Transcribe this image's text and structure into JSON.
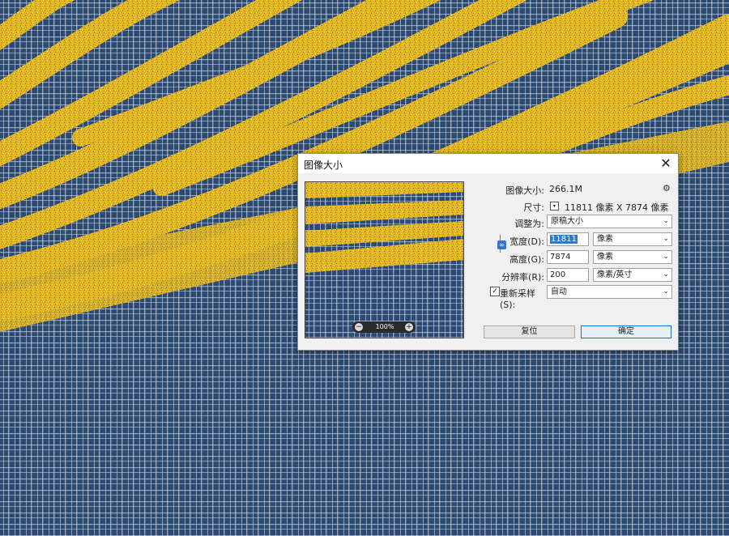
{
  "dialog": {
    "title": "图像大小",
    "close": "✕",
    "image_size_label": "图像大小:",
    "image_size_value": "266.1M",
    "dimensions_label": "尺寸:",
    "dimensions_value": "11811 像素  X  7874 像素",
    "fit_to_label": "调整为:",
    "fit_to_value": "原稿大小",
    "width_label": "宽度(D):",
    "width_value": "11811",
    "width_unit": "像素",
    "height_label": "高度(G):",
    "height_value": "7874",
    "height_unit": "像素",
    "resolution_label": "分辨率(R):",
    "resolution_value": "200",
    "resolution_unit": "像素/英寸",
    "resample_label": "重新采样(S):",
    "resample_value": "自动",
    "reset_button": "复位",
    "ok_button": "确定",
    "zoom_value": "100%",
    "gear_icon": "⚙",
    "dropdown_icon": "▾",
    "check": "✓"
  },
  "colors": {
    "background_blue": "#2d4a72",
    "gold": "#e6b81e",
    "accent": "#1d6fc4"
  }
}
